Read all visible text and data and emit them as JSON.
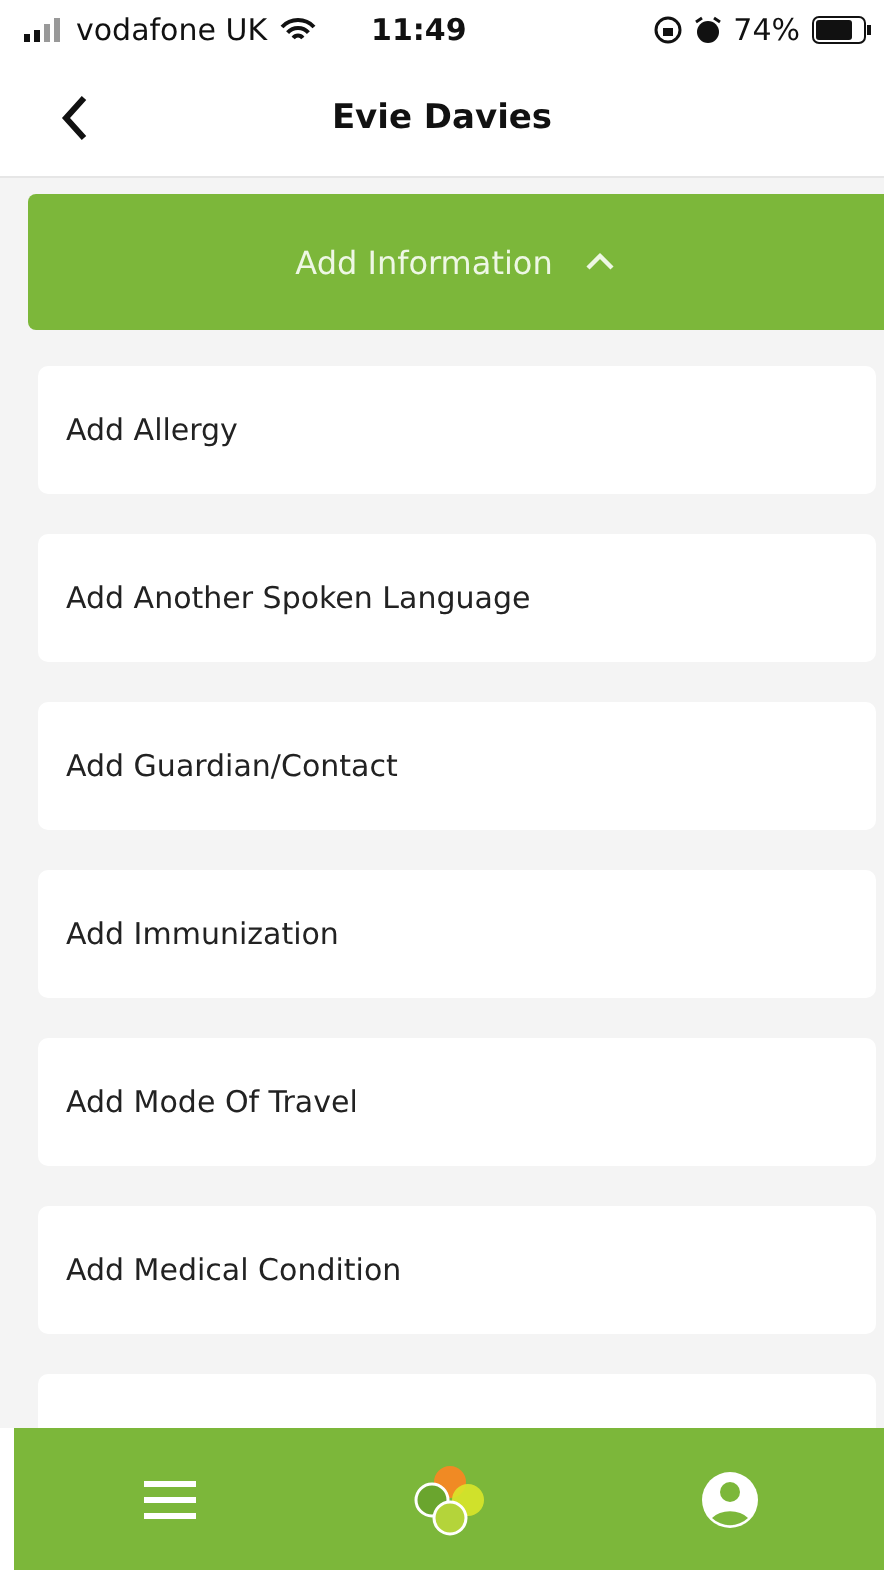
{
  "status_bar": {
    "carrier": "vodafone UK",
    "time": "11:49",
    "battery": "74%"
  },
  "header": {
    "title": "Evie Davies"
  },
  "section": {
    "label": "Add Information",
    "expanded": true
  },
  "items": [
    {
      "label": "Add Allergy"
    },
    {
      "label": "Add Another Spoken Language"
    },
    {
      "label": "Add Guardian/Contact"
    },
    {
      "label": "Add Immunization"
    },
    {
      "label": "Add Mode Of Travel"
    },
    {
      "label": "Add Medical Condition"
    }
  ]
}
